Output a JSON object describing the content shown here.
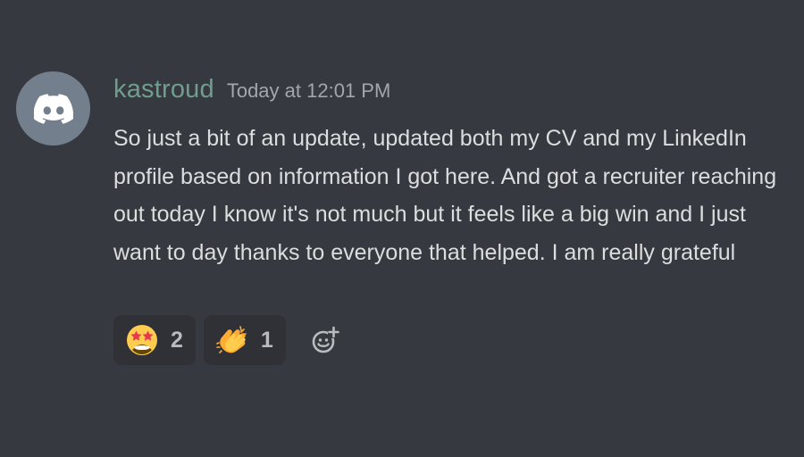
{
  "message": {
    "author": "kastroud",
    "timestamp": "Today at 12:01 PM",
    "content": "So just a bit of an update, updated both my CV and my LinkedIn profile based on information I got here. And got a recruiter reaching out today I know it's not much but it feels like a big win and I just want to day thanks to everyone that helped. I am really grateful"
  },
  "avatar": {
    "icon": "discord-logo-icon",
    "color": "#747f8d"
  },
  "reactions": [
    {
      "icon": "star-struck-emoji-icon",
      "count": "2"
    },
    {
      "icon": "clapping-hands-emoji-icon",
      "count": "1"
    }
  ],
  "add_reaction": {
    "icon": "add-reaction-icon"
  },
  "colors": {
    "background": "#36393f",
    "username": "#6f9e8d",
    "text": "#dcddde",
    "timestamp": "#a3a6aa",
    "reaction_bg": "#2f3136"
  }
}
